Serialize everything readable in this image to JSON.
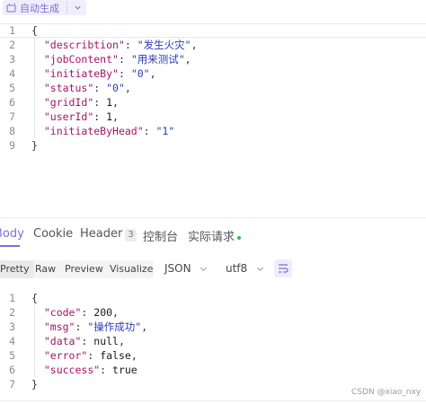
{
  "toolbar": {
    "generate_label": "自动生成"
  },
  "request_body": [
    {
      "n": "1",
      "parts": [
        [
          "p",
          "{"
        ]
      ]
    },
    {
      "n": "2",
      "parts": [
        [
          "p",
          "  "
        ],
        [
          "k",
          "\"describtion\""
        ],
        [
          "p",
          ": "
        ],
        [
          "s",
          "\"发生火灾\""
        ],
        [
          "p",
          ","
        ]
      ]
    },
    {
      "n": "3",
      "parts": [
        [
          "p",
          "  "
        ],
        [
          "k",
          "\"jobContent\""
        ],
        [
          "p",
          ": "
        ],
        [
          "s",
          "\"用来测试\""
        ],
        [
          "p",
          ","
        ]
      ]
    },
    {
      "n": "4",
      "parts": [
        [
          "p",
          "  "
        ],
        [
          "k",
          "\"initiateBy\""
        ],
        [
          "p",
          ": "
        ],
        [
          "s",
          "\"0\""
        ],
        [
          "p",
          ","
        ]
      ]
    },
    {
      "n": "5",
      "parts": [
        [
          "p",
          "  "
        ],
        [
          "k",
          "\"status\""
        ],
        [
          "p",
          ": "
        ],
        [
          "s",
          "\"0\""
        ],
        [
          "p",
          ","
        ]
      ]
    },
    {
      "n": "6",
      "parts": [
        [
          "p",
          "  "
        ],
        [
          "k",
          "\"gridId\""
        ],
        [
          "p",
          ": "
        ],
        [
          "v",
          "1"
        ],
        [
          "p",
          ","
        ]
      ]
    },
    {
      "n": "7",
      "parts": [
        [
          "p",
          "  "
        ],
        [
          "k",
          "\"userId\""
        ],
        [
          "p",
          ": "
        ],
        [
          "v",
          "1"
        ],
        [
          "p",
          ","
        ]
      ]
    },
    {
      "n": "8",
      "parts": [
        [
          "p",
          "  "
        ],
        [
          "k",
          "\"initiateByHead\""
        ],
        [
          "p",
          ": "
        ],
        [
          "s",
          "\"1\""
        ]
      ]
    },
    {
      "n": "9",
      "parts": [
        [
          "p",
          "}"
        ]
      ]
    }
  ],
  "response_tabs": {
    "body": "Body",
    "cookie": "Cookie",
    "header": "Header",
    "header_count": "3",
    "console": "控制台",
    "actual_request": "实际请求"
  },
  "view_modes": {
    "pretty": "Pretty",
    "raw": "Raw",
    "preview": "Preview",
    "visualize": "Visualize"
  },
  "format_select": "JSON",
  "encoding_select": "utf8",
  "response_body": [
    {
      "n": "1",
      "parts": [
        [
          "p",
          "{"
        ]
      ]
    },
    {
      "n": "2",
      "parts": [
        [
          "p",
          "  "
        ],
        [
          "k",
          "\"code\""
        ],
        [
          "p",
          ": "
        ],
        [
          "v",
          "200"
        ],
        [
          "p",
          ","
        ]
      ]
    },
    {
      "n": "3",
      "parts": [
        [
          "p",
          "  "
        ],
        [
          "k",
          "\"msg\""
        ],
        [
          "p",
          ": "
        ],
        [
          "s",
          "\"操作成功\""
        ],
        [
          "p",
          ","
        ]
      ]
    },
    {
      "n": "4",
      "parts": [
        [
          "p",
          "  "
        ],
        [
          "k",
          "\"data\""
        ],
        [
          "p",
          ": "
        ],
        [
          "v",
          "null"
        ],
        [
          "p",
          ","
        ]
      ]
    },
    {
      "n": "5",
      "parts": [
        [
          "p",
          "  "
        ],
        [
          "k",
          "\"error\""
        ],
        [
          "p",
          ": "
        ],
        [
          "v",
          "false"
        ],
        [
          "p",
          ","
        ]
      ]
    },
    {
      "n": "6",
      "parts": [
        [
          "p",
          "  "
        ],
        [
          "k",
          "\"success\""
        ],
        [
          "p",
          ": "
        ],
        [
          "v",
          "true"
        ]
      ]
    },
    {
      "n": "7",
      "parts": [
        [
          "p",
          "}"
        ]
      ]
    }
  ],
  "watermark": "CSDN @xiao_nxy",
  "colors": {
    "accent": "#7b6fd8",
    "json_key": "#a2146a",
    "json_string": "#2f3bb5",
    "status_dot": "#3fb950"
  }
}
